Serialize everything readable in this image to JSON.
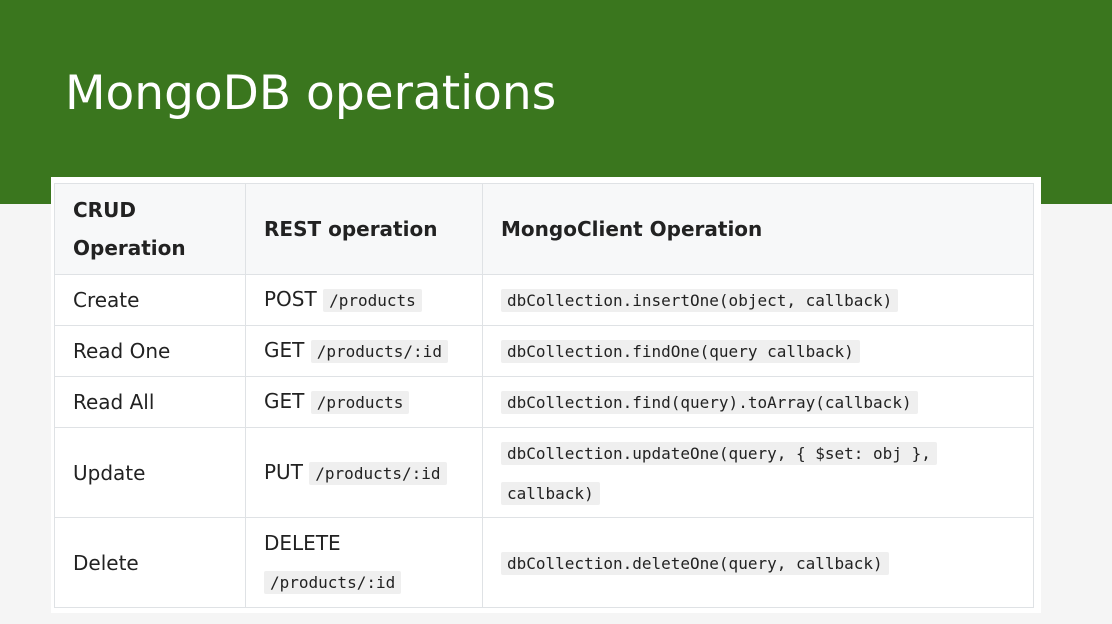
{
  "slide": {
    "title": "MongoDB operations",
    "colors": {
      "header_band": "#3a761e",
      "title_text": "#ffffff",
      "background": "#f5f5f5"
    }
  },
  "table": {
    "headers": {
      "crud": "CRUD Operation",
      "rest": "REST operation",
      "mongo": "MongoClient Operation"
    },
    "rows": [
      {
        "crud": "Create",
        "rest_method": "POST",
        "rest_path": "/products",
        "mongo_code": "dbCollection.insertOne(object, callback)"
      },
      {
        "crud": "Read One",
        "rest_method": "GET",
        "rest_path": "/products/:id",
        "mongo_code": "dbCollection.findOne(query callback)"
      },
      {
        "crud": "Read All",
        "rest_method": "GET",
        "rest_path": "/products",
        "mongo_code": "dbCollection.find(query).toArray(callback)"
      },
      {
        "crud": "Update",
        "rest_method": "PUT",
        "rest_path": "/products/:id",
        "mongo_code_line1": "dbCollection.updateOne(query, { $set: obj },",
        "mongo_code_line2": "callback)"
      },
      {
        "crud": "Delete",
        "rest_method": "DELETE",
        "rest_path": "/products/:id",
        "mongo_code": "dbCollection.deleteOne(query, callback)"
      }
    ]
  }
}
